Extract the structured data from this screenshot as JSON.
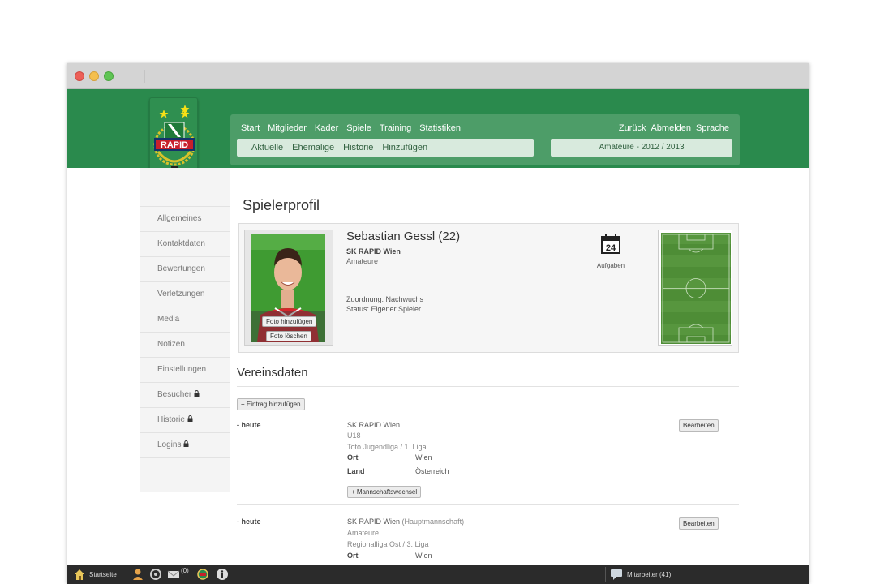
{
  "nav": {
    "main": [
      "Start",
      "Mitglieder",
      "Kader",
      "Spiele",
      "Training",
      "Statistiken"
    ],
    "right": [
      "Zurück",
      "Abmelden",
      "Sprache"
    ],
    "sub": [
      "Aktuelle",
      "Ehemalige",
      "Historie",
      "Hinzufügen"
    ],
    "season": "Amateure - 2012 / 2013"
  },
  "logo": {
    "text": "RAPID"
  },
  "sidebar": {
    "items": [
      {
        "label": "Allgemeines",
        "locked": false
      },
      {
        "label": "Kontaktdaten",
        "locked": false
      },
      {
        "label": "Bewertungen",
        "locked": false
      },
      {
        "label": "Verletzungen",
        "locked": false
      },
      {
        "label": "Media",
        "locked": false
      },
      {
        "label": "Notizen",
        "locked": false
      },
      {
        "label": "Einstellungen",
        "locked": false
      },
      {
        "label": "Besucher",
        "locked": true
      },
      {
        "label": "Historie",
        "locked": true
      },
      {
        "label": "Logins",
        "locked": true
      }
    ]
  },
  "page": {
    "title": "Spielerprofil"
  },
  "profile": {
    "name": "Sebastian Gessl (22)",
    "club": "SK RAPID Wien",
    "type": "Amateure",
    "assignment": "Zuordnung: Nachwuchs",
    "status": "Status: Eigener Spieler",
    "photo_add": "Foto hinzufügen",
    "photo_delete": "Foto löschen",
    "calendar_day": "24",
    "tasks_label": "Aufgaben"
  },
  "vereinsdaten": {
    "title": "Vereinsdaten",
    "add_button": "+ Eintrag hinzufügen",
    "entries": [
      {
        "period": "- heute",
        "club": "SK RAPID Wien",
        "club_suffix": "",
        "team": "U18",
        "league": "Toto Jugendliga / 1. Liga",
        "ort_label": "Ort",
        "ort": "Wien",
        "land_label": "Land",
        "land": "Österreich",
        "edit": "Bearbeiten",
        "change_button": "+ Mannschaftswechsel"
      },
      {
        "period": "- heute",
        "club": "SK RAPID Wien",
        "club_suffix": " (Hauptmannschaft)",
        "team": "Amateure",
        "league": "Regionalliga Ost / 3. Liga",
        "ort_label": "Ort",
        "ort": "Wien",
        "edit": "Bearbeiten"
      }
    ]
  },
  "taskbar": {
    "home": "Startseite",
    "mail_count": "(0)",
    "staff": "Mitarbeiter (41)"
  },
  "colors": {
    "header_green": "#2a8a4d",
    "nav_green": "#4d9d68",
    "subnav_bg": "#d8eadd",
    "taskbar": "#2b2b2b"
  }
}
